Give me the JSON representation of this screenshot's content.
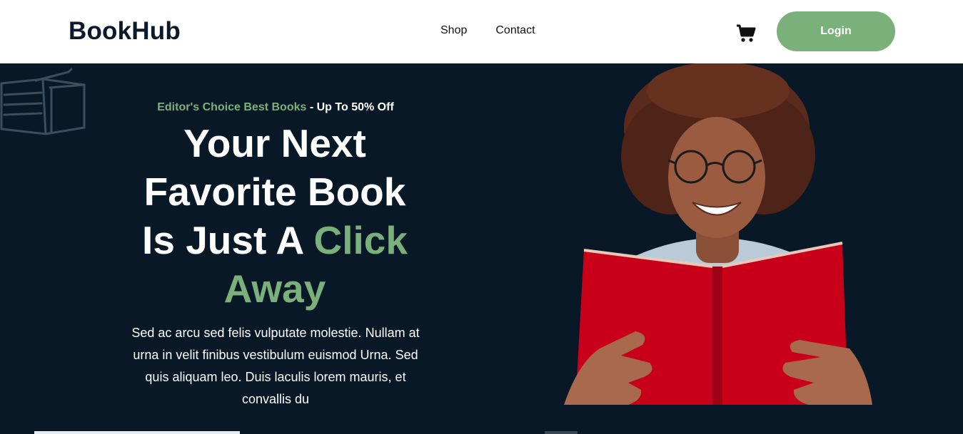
{
  "brand": {
    "name": "BookHub"
  },
  "nav": {
    "shop": "Shop",
    "contact": "Contact"
  },
  "header": {
    "cart_icon": "cart-icon",
    "login_label": "Login"
  },
  "hero": {
    "tagline_accent": "Editor's Choice Best Books",
    "tagline_rest": " - Up To 50% Off",
    "headline_line1": "Your Next",
    "headline_line2": "Favorite Book",
    "headline_line3_white": "Is Just A ",
    "headline_line3_accent": "Click",
    "headline_line4_accent": "Away",
    "description": "Sed ac arcu sed felis vulputate molestie. Nullam at urna in velit finibus vestibulum euismod Urna. Sed quis aliquam leo. Duis laculis lorem mauris, et convallis du"
  },
  "colors": {
    "accent": "#7ab07a",
    "hero_bg": "#081826",
    "book_red": "#c8001a"
  }
}
